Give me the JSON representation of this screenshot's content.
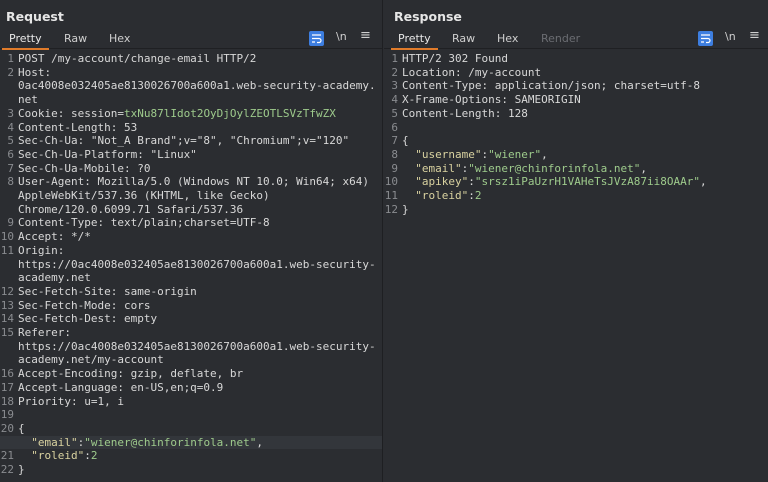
{
  "view_switch": [
    "side-by-side",
    "horizontal",
    "vertical"
  ],
  "request": {
    "title": "Request",
    "tabs": [
      "Pretty",
      "Raw",
      "Hex"
    ],
    "newline_label": "\\n",
    "lines": [
      {
        "n": "1",
        "t": "POST /my-account/change-email HTTP/2"
      },
      {
        "n": "2",
        "t": "Host:"
      },
      {
        "n": "",
        "t": "0ac4008e032405ae8130026700a600a1.web-security-academy."
      },
      {
        "n": "",
        "t": "net"
      },
      {
        "n": "3",
        "t": "Cookie: session=",
        "v": "txNu87lIdot2OyDjOylZEOTLSVzTfwZX"
      },
      {
        "n": "4",
        "t": "Content-Length: 53"
      },
      {
        "n": "5",
        "t": "Sec-Ch-Ua: \"Not_A Brand\";v=\"8\", \"Chromium\";v=\"120\""
      },
      {
        "n": "6",
        "t": "Sec-Ch-Ua-Platform: \"Linux\""
      },
      {
        "n": "7",
        "t": "Sec-Ch-Ua-Mobile: ?0"
      },
      {
        "n": "8",
        "t": "User-Agent: Mozilla/5.0 (Windows NT 10.0; Win64; x64)"
      },
      {
        "n": "",
        "t": "AppleWebKit/537.36 (KHTML, like Gecko)"
      },
      {
        "n": "",
        "t": "Chrome/120.0.6099.71 Safari/537.36"
      },
      {
        "n": "9",
        "t": "Content-Type: text/plain;charset=UTF-8"
      },
      {
        "n": "10",
        "t": "Accept: */*"
      },
      {
        "n": "11",
        "t": "Origin:"
      },
      {
        "n": "",
        "t": "https://0ac4008e032405ae8130026700a600a1.web-security-"
      },
      {
        "n": "",
        "t": "academy.net"
      },
      {
        "n": "12",
        "t": "Sec-Fetch-Site: same-origin"
      },
      {
        "n": "13",
        "t": "Sec-Fetch-Mode: cors"
      },
      {
        "n": "14",
        "t": "Sec-Fetch-Dest: empty"
      },
      {
        "n": "15",
        "t": "Referer:"
      },
      {
        "n": "",
        "t": "https://0ac4008e032405ae8130026700a600a1.web-security-"
      },
      {
        "n": "",
        "t": "academy.net/my-account"
      },
      {
        "n": "16",
        "t": "Accept-Encoding: gzip, deflate, br"
      },
      {
        "n": "17",
        "t": "Accept-Language: en-US,en;q=0.9"
      },
      {
        "n": "18",
        "t": "Priority: u=1, i"
      },
      {
        "n": "19",
        "t": ""
      },
      {
        "n": "20",
        "t": "{"
      },
      {
        "n": "",
        "t": "  ",
        "k": "\"email\"",
        "s": ":",
        "v": "\"wiener@chinforinfola.net\"",
        "e": ","
      },
      {
        "n": "21",
        "t": "  ",
        "k": "\"roleid\"",
        "s": ":",
        "v": "2"
      },
      {
        "n": "22",
        "t": "}"
      }
    ]
  },
  "response": {
    "title": "Response",
    "tabs": [
      "Pretty",
      "Raw",
      "Hex",
      "Render"
    ],
    "newline_label": "\\n",
    "lines": [
      {
        "n": "1",
        "t": "HTTP/2 302 Found"
      },
      {
        "n": "2",
        "t": "Location: /my-account"
      },
      {
        "n": "3",
        "t": "Content-Type: application/json; charset=utf-8"
      },
      {
        "n": "4",
        "t": "X-Frame-Options: SAMEORIGIN"
      },
      {
        "n": "5",
        "t": "Content-Length: 128"
      },
      {
        "n": "6",
        "t": ""
      },
      {
        "n": "7",
        "t": "{"
      },
      {
        "n": "8",
        "t": "  ",
        "k": "\"username\"",
        "s": ":",
        "v": "\"wiener\"",
        "e": ","
      },
      {
        "n": "9",
        "t": "  ",
        "k": "\"email\"",
        "s": ":",
        "v": "\"wiener@chinforinfola.net\"",
        "e": ","
      },
      {
        "n": "10",
        "t": "  ",
        "k": "\"apikey\"",
        "s": ":",
        "v": "\"srsz1iPaUzrH1VAHeTsJVzA87ii8OAAr\"",
        "e": ","
      },
      {
        "n": "11",
        "t": "  ",
        "k": "\"roleid\"",
        "s": ":",
        "v": "2"
      },
      {
        "n": "12",
        "t": "}"
      }
    ]
  },
  "colors": {
    "accent_tab": "#e07b2a",
    "wrap_button": "#3d7ee0",
    "json_key": "#d9d2a0",
    "json_value": "#9ecb8c"
  }
}
